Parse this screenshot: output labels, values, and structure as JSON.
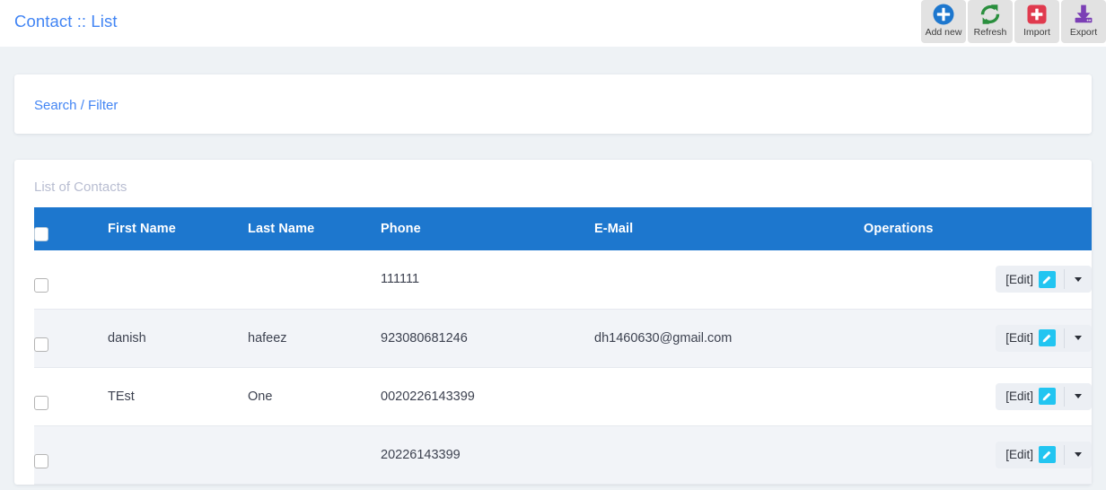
{
  "header": {
    "title": "Contact :: List",
    "toolbar": [
      {
        "label": "Add new",
        "icon": "plus-circle-icon",
        "color": "#1d77ce"
      },
      {
        "label": "Refresh",
        "icon": "refresh-icon",
        "color": "#2a8f3e"
      },
      {
        "label": "Import",
        "icon": "plus-square-icon",
        "color": "#e03a4e"
      },
      {
        "label": "Export",
        "icon": "download-icon",
        "color": "#7b3fb5"
      }
    ]
  },
  "search_card": {
    "link_label": "Search / Filter"
  },
  "list_card": {
    "title": "List of Contacts",
    "columns": {
      "select": "",
      "first_name": "First Name",
      "last_name": "Last Name",
      "phone": "Phone",
      "email": "E-Mail",
      "operations": "Operations"
    },
    "rows": [
      {
        "first_name": "",
        "last_name": "",
        "phone": "111111",
        "email": "",
        "edit_label": "[Edit]"
      },
      {
        "first_name": "danish",
        "last_name": "hafeez",
        "phone": "923080681246",
        "email": "dh1460630@gmail.com",
        "edit_label": "[Edit]"
      },
      {
        "first_name": "TEst",
        "last_name": "One",
        "phone": "0020226143399",
        "email": "",
        "edit_label": "[Edit]"
      },
      {
        "first_name": "",
        "last_name": "",
        "phone": "20226143399",
        "email": "",
        "edit_label": "[Edit]"
      }
    ]
  },
  "colors": {
    "accent_blue": "#1d77ce",
    "link_blue": "#4285f4",
    "edit_cyan": "#22c5f1",
    "page_bg": "#eef2f5",
    "row_alt": "#f2f4f8"
  }
}
